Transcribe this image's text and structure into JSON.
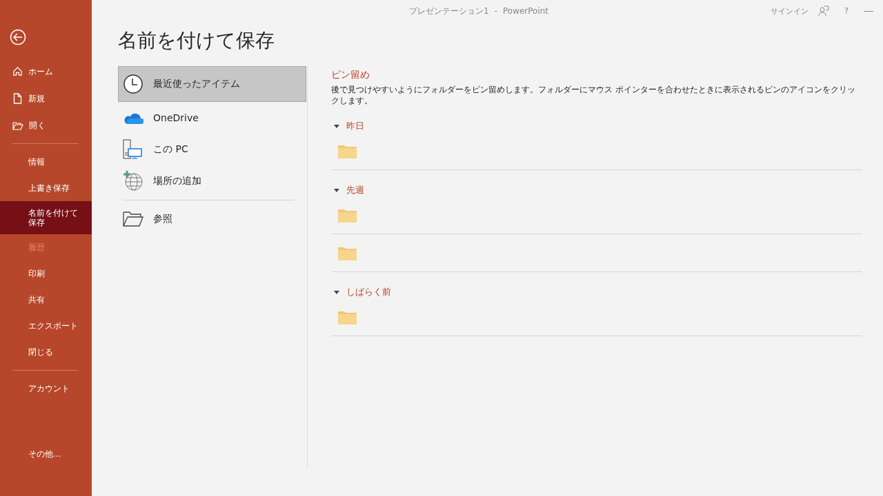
{
  "title_bar": {
    "document": "プレゼンテーション1",
    "separator": "-",
    "app": "PowerPoint",
    "sign_in": "サインイン",
    "help": "?"
  },
  "sidebar": {
    "items": [
      {
        "kind": "home",
        "label": "ホーム",
        "selected": false,
        "disabled": false
      },
      {
        "kind": "new",
        "label": "新規",
        "selected": false,
        "disabled": false
      },
      {
        "kind": "open",
        "label": "開く",
        "selected": false,
        "disabled": false
      },
      {
        "kind": "divider"
      },
      {
        "kind": "nav",
        "label": "情報",
        "selected": false,
        "disabled": false
      },
      {
        "kind": "nav",
        "label": "上書き保存",
        "selected": false,
        "disabled": false
      },
      {
        "kind": "nav",
        "label": "名前を付けて保存",
        "selected": true,
        "disabled": false
      },
      {
        "kind": "nav",
        "label": "履歴",
        "selected": false,
        "disabled": true
      },
      {
        "kind": "nav",
        "label": "印刷",
        "selected": false,
        "disabled": false
      },
      {
        "kind": "nav",
        "label": "共有",
        "selected": false,
        "disabled": false
      },
      {
        "kind": "nav",
        "label": "エクスポート",
        "selected": false,
        "disabled": false
      },
      {
        "kind": "nav",
        "label": "閉じる",
        "selected": false,
        "disabled": false
      },
      {
        "kind": "divider"
      },
      {
        "kind": "nav",
        "label": "アカウント",
        "selected": false,
        "disabled": false
      }
    ],
    "more": "その他..."
  },
  "page_title": "名前を付けて保存",
  "locations": [
    {
      "kind": "clock",
      "label": "最近使ったアイテム",
      "selected": true
    },
    {
      "kind": "cloud",
      "label": "OneDrive",
      "selected": false
    },
    {
      "kind": "pc",
      "label": "この PC",
      "selected": false
    },
    {
      "kind": "globe",
      "label": "場所の追加",
      "selected": false
    },
    {
      "kind": "divider"
    },
    {
      "kind": "folder",
      "label": "参照",
      "selected": false
    }
  ],
  "pinned": {
    "title": "ピン留め",
    "description": "後で見つけやすいようにフォルダーをピン留めします。フォルダーにマウス ポインターを合わせたときに表示されるピンのアイコンをクリックします。"
  },
  "groups": [
    {
      "label": "昨日",
      "expanded": true,
      "rows": [
        {
          "kind": "folder"
        }
      ]
    },
    {
      "label": "先週",
      "expanded": true,
      "rows": [
        {
          "kind": "folder"
        },
        {
          "kind": "folder"
        }
      ]
    },
    {
      "label": "しばらく前",
      "expanded": true,
      "rows": [
        {
          "kind": "folder"
        }
      ]
    }
  ]
}
